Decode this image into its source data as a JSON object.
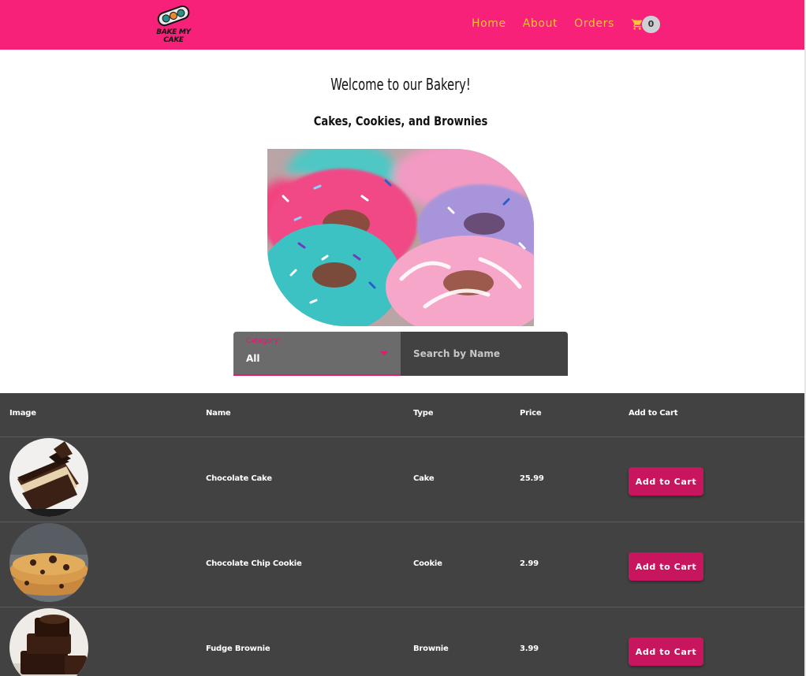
{
  "header": {
    "logo_text": "BAKE MY CAKE",
    "nav": [
      {
        "label": "Home"
      },
      {
        "label": "About"
      },
      {
        "label": "Orders"
      }
    ],
    "cart_count": "0"
  },
  "hero": {
    "title": "Welcome to our Bakery!",
    "subtitle": "Cakes, Cookies, and Brownies"
  },
  "filters": {
    "category_label": "Category:",
    "category_value": "All",
    "search_placeholder": "Search by Name"
  },
  "table": {
    "headers": {
      "image": "Image",
      "name": "Name",
      "type": "Type",
      "price": "Price",
      "cart": "Add to Cart"
    },
    "rows": [
      {
        "name": "Chocolate Cake",
        "type": "Cake",
        "price": "25.99",
        "button": "Add to Cart"
      },
      {
        "name": "Chocolate Chip Cookie",
        "type": "Cookie",
        "price": "2.99",
        "button": "Add to Cart"
      },
      {
        "name": "Fudge Brownie",
        "type": "Brownie",
        "price": "3.99",
        "button": "Add to Cart"
      }
    ]
  },
  "colors": {
    "header_bg": "#f7217a",
    "nav_text": "#ffc13b",
    "table_bg": "#424242",
    "button_bg": "#c8165e"
  },
  "icons": [
    "cake-logo-icon",
    "shopping-cart-icon",
    "dropdown-arrow-icon"
  ]
}
